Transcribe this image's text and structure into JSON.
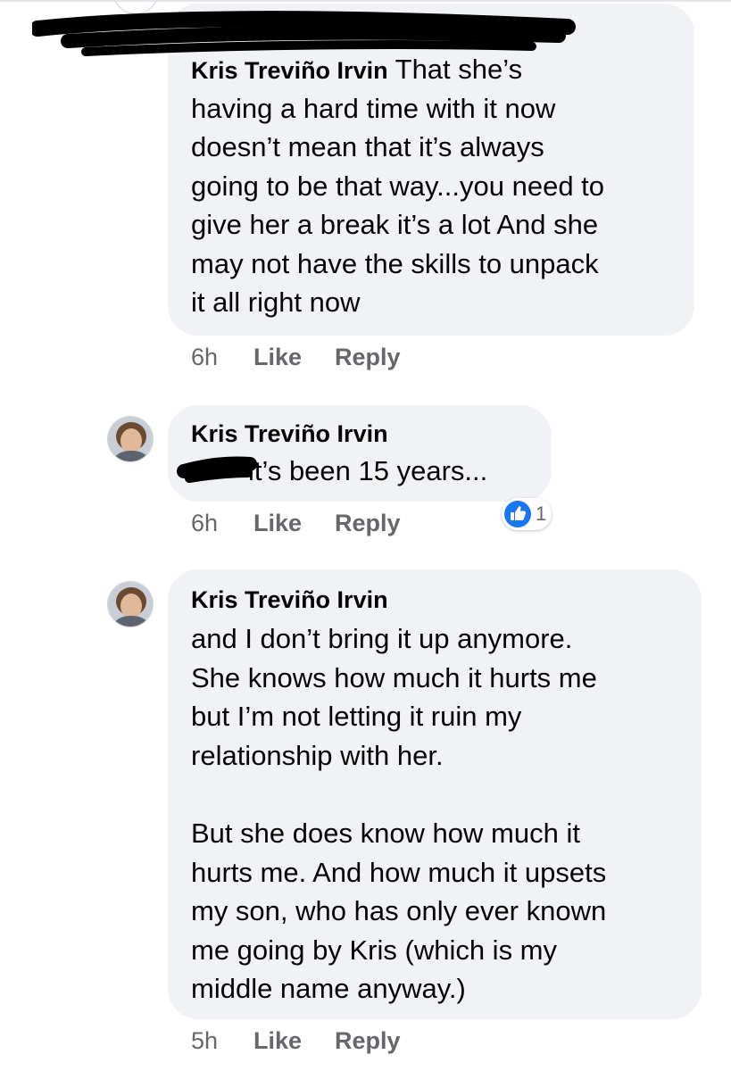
{
  "comments": [
    {
      "author": "Kris Treviño Irvin",
      "text": "That she’s having a hard time with it now doesn’t mean that it’s always going to be that way...you need to give her a break it’s a lot And she may not have the skills to unpack it all right now",
      "lines": [
        "having a hard time with it now",
        "doesn’t mean that it’s always",
        "going to be that way...you need to",
        "give her a break it’s a lot And she",
        "may not have the skills to unpack",
        "it all right now"
      ],
      "first_line_text": " That she’s",
      "time": "6h",
      "like_label": "Like",
      "reply_label": "Reply"
    },
    {
      "author": "Kris Treviño Irvin",
      "text": "it’s been 15 years...",
      "time": "6h",
      "like_label": "Like",
      "reply_label": "Reply",
      "reaction_count": "1"
    },
    {
      "author": "Kris Treviño Irvin",
      "paragraph1": "and I don’t bring it up anymore.\nShe knows how much it hurts me\nbut I’m not letting it ruin my\nrelationship with her.",
      "paragraph2": "But she does know how much it\nhurts me. And how much it upsets\nmy son, who has only ever known\nme going by Kris (which is my\nmiddle name anyway.)",
      "time": "5h",
      "like_label": "Like",
      "reply_label": "Reply"
    }
  ],
  "colors": {
    "bubble": "#f0f2f5",
    "meta_text": "#65676b",
    "like_blue": "#1877f2",
    "redaction": "#000000"
  },
  "icons": {
    "reaction": "like-thumbs-up-icon",
    "avatar": "user-avatar"
  }
}
